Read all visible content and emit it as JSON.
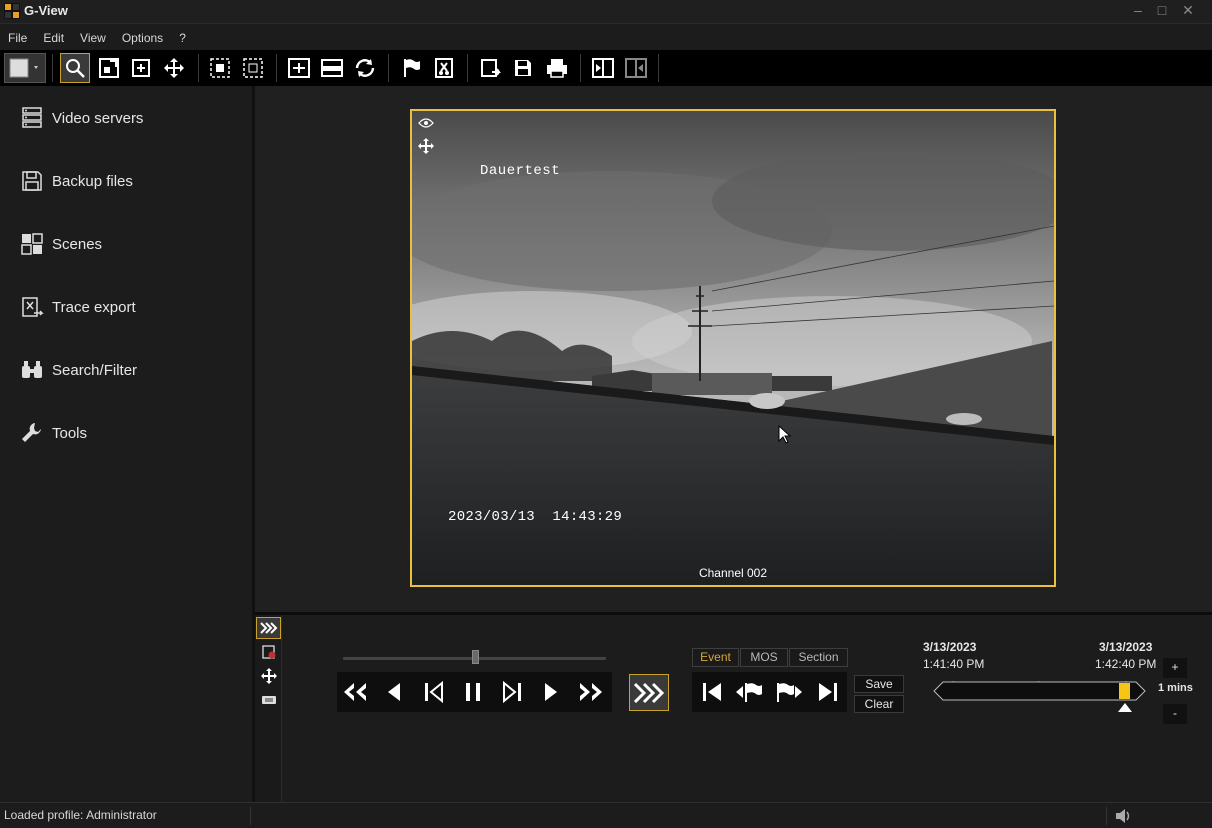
{
  "window": {
    "title": "G-View",
    "controls": {
      "minimize": "–",
      "maximize": "□",
      "close": "✕"
    }
  },
  "menu": [
    "File",
    "Edit",
    "View",
    "Options",
    "?"
  ],
  "toolbar": {
    "icons": [
      "layout-picker-icon",
      "zoom-icon",
      "fit-icon",
      "fullscreen-icon",
      "move-icon",
      "select-icon",
      "deselect-icon",
      "stretch-icon",
      "bar-icon",
      "refresh-icon",
      "flag-icon",
      "cut-icon",
      "export-icon",
      "save-icon",
      "print-icon",
      "split-left-icon",
      "split-right-icon"
    ],
    "active": "zoom-icon"
  },
  "sidebar": {
    "items": [
      {
        "label": "Video servers",
        "icon": "server-icon"
      },
      {
        "label": "Backup files",
        "icon": "floppy-icon"
      },
      {
        "label": "Scenes",
        "icon": "scenes-icon"
      },
      {
        "label": "Trace export",
        "icon": "trace-export-icon"
      },
      {
        "label": "Search/Filter",
        "icon": "binoculars-icon"
      },
      {
        "label": "Tools",
        "icon": "wrench-icon"
      }
    ]
  },
  "video": {
    "osd_title": "Dauertest",
    "osd_timestamp": "2023/03/13  14:43:29",
    "channel": "Channel 002",
    "border_color": "#e8c23a"
  },
  "playback": {
    "mode_tabs": [
      "Event",
      "MOS",
      "Section"
    ],
    "active_mode": "Event",
    "save_label": "Save",
    "clear_label": "Clear",
    "slider_position": 0.5
  },
  "timeline": {
    "start_date": "3/13/2023",
    "start_time": "1:41:40 PM",
    "end_date": "3/13/2023",
    "end_time": "1:42:40 PM",
    "zoom_in": "+",
    "zoom_out": "-",
    "scale": "1 mins",
    "marker_color": "#f5c518"
  },
  "status": {
    "text": "Loaded profile: Administrator",
    "volume_icon": "speaker-icon"
  },
  "colors": {
    "accent": "#c9a227",
    "event_active": "#d6a53b"
  }
}
